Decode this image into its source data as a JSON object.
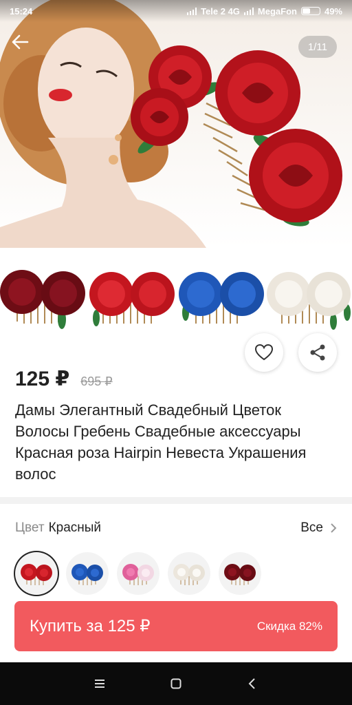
{
  "status_bar": {
    "time": "15:24",
    "carrier1": "Tele 2 4G",
    "carrier2": "MegaFon",
    "battery": "49%"
  },
  "gallery": {
    "counter": "1/11",
    "thumbnails": [
      "dark-red",
      "red",
      "blue",
      "white"
    ]
  },
  "product": {
    "price": "125 ₽",
    "old_price": "695 ₽",
    "title": "Дамы Элегантный Свадебный Цветок Волосы Гребень Свадебные аксессуары Красная роза Hairpin Невеста Украшения волос"
  },
  "color_selector": {
    "label": "Цвет",
    "value": "Красный",
    "all_label": "Все",
    "swatches": [
      {
        "name": "red",
        "selected": true
      },
      {
        "name": "blue",
        "selected": false
      },
      {
        "name": "pink",
        "selected": false
      },
      {
        "name": "white",
        "selected": false
      },
      {
        "name": "burgundy",
        "selected": false
      }
    ]
  },
  "buy_bar": {
    "label": "Купить за 125 ₽",
    "discount": "Скидка 82%"
  },
  "colors": {
    "accent": "#f25a5e",
    "rose_red": "#c4161f",
    "rose_dark": "#7a0f19",
    "rose_blue": "#1f57b8",
    "rose_white": "#f3efe8",
    "rose_pink": "#e0609a"
  },
  "icons": {
    "back": "arrow-left-icon",
    "like": "heart-icon",
    "share": "share-icon",
    "chevron": "chevron-right-icon",
    "nav_menu": "menu-icon",
    "nav_home": "square-icon",
    "nav_back": "chevron-left-icon"
  }
}
